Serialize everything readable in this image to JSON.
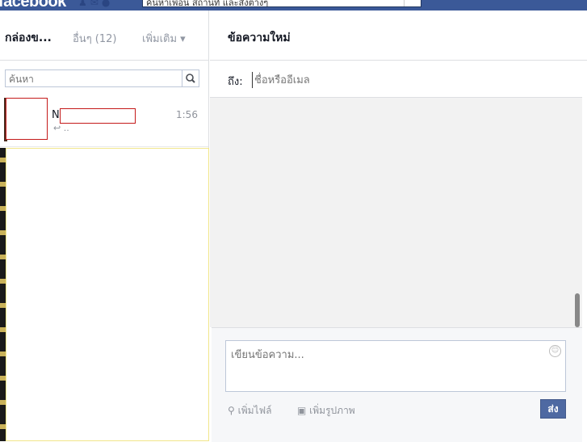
{
  "topbar": {
    "logo": "facebook",
    "search_value": "ค้นหาเพื่อน สถานที่ และสิ่งต่างๆ",
    "jewels": [
      "friend-requests-icon",
      "messages-icon",
      "notifications-icon"
    ]
  },
  "left": {
    "inbox_label": "กล่องข...",
    "other_label": "อื่นๆ (12)",
    "more_label": "เพิ่มเติม ▾",
    "search_placeholder": "ค้นหา",
    "thread": {
      "name_initial": "N",
      "time": "1:56",
      "snippet": "↩ .."
    }
  },
  "right": {
    "title": "ข้อความใหม่",
    "to_label": "ถึง:",
    "to_placeholder": "ชื่อหรืออีเมล",
    "message_placeholder": "เขียนข้อความ...",
    "attach_label": "เพิ่มไฟล์",
    "photo_label": "เพิ่มรูปภาพ",
    "send_label": "ส่ง"
  },
  "colors": {
    "brand": "#3b5998",
    "send": "#4e69a2",
    "redaction": "#c41a1a"
  }
}
